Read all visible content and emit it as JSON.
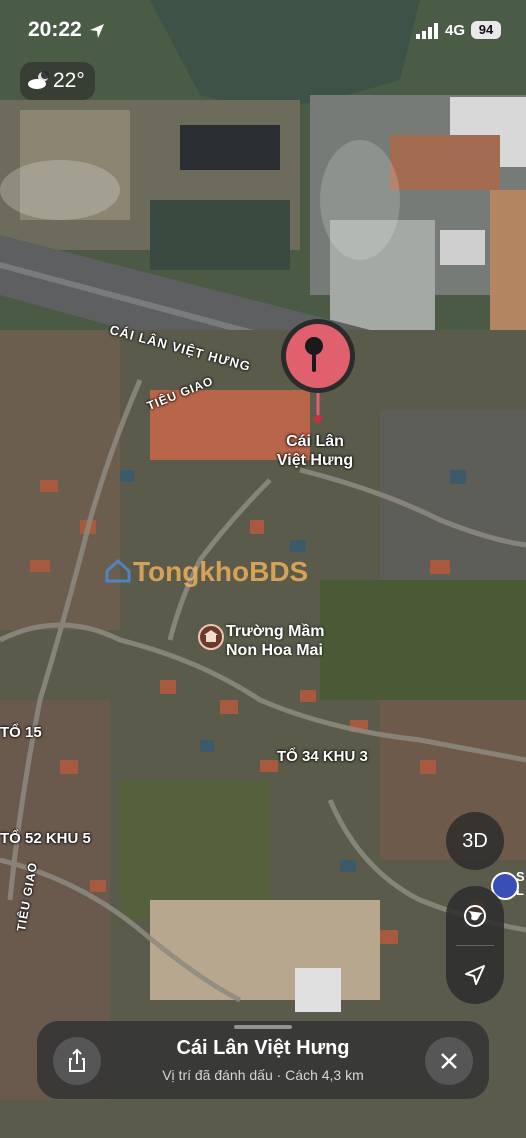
{
  "status_bar": {
    "time": "20:22",
    "network": "4G",
    "battery": "94",
    "icons": [
      "location-arrow-icon",
      "signal-bars-icon"
    ]
  },
  "weather": {
    "temperature": "22°",
    "icon": "cloud-moon-icon"
  },
  "map": {
    "roads": [
      {
        "name": "CÁI LÂN VIỆT HƯNG"
      },
      {
        "name": "TIÊU GIAO"
      },
      {
        "name": "TIÊU GIAO"
      }
    ],
    "areas": [
      "TỔ 15",
      "TỔ 34 KHU 3",
      "TỔ 52 KHU 5"
    ],
    "pin": {
      "title_line1": "Cái Lân",
      "title_line2": "Việt Hưng",
      "color": "#e0606e"
    },
    "poi": {
      "name_line1": "Trường Mầm",
      "name_line2": "Non Hoa Mai",
      "icon": "school-icon"
    },
    "watermark": "TongkhoBDS",
    "edge_poi": {
      "label": "S\nL"
    }
  },
  "controls": {
    "three_d_label": "3D",
    "globe_icon": "globe-icon",
    "locate_icon": "location-arrow-icon"
  },
  "place_sheet": {
    "title": "Cái Lân Việt Hưng",
    "subtitle": "Vị trí đã đánh dấu · Cách 4,3 km",
    "share_icon": "share-icon",
    "close_icon": "close-icon"
  },
  "colors": {
    "pin": "#e0606e",
    "accent_blue": "#3a4fb5",
    "watermark": "#ffb95a"
  }
}
